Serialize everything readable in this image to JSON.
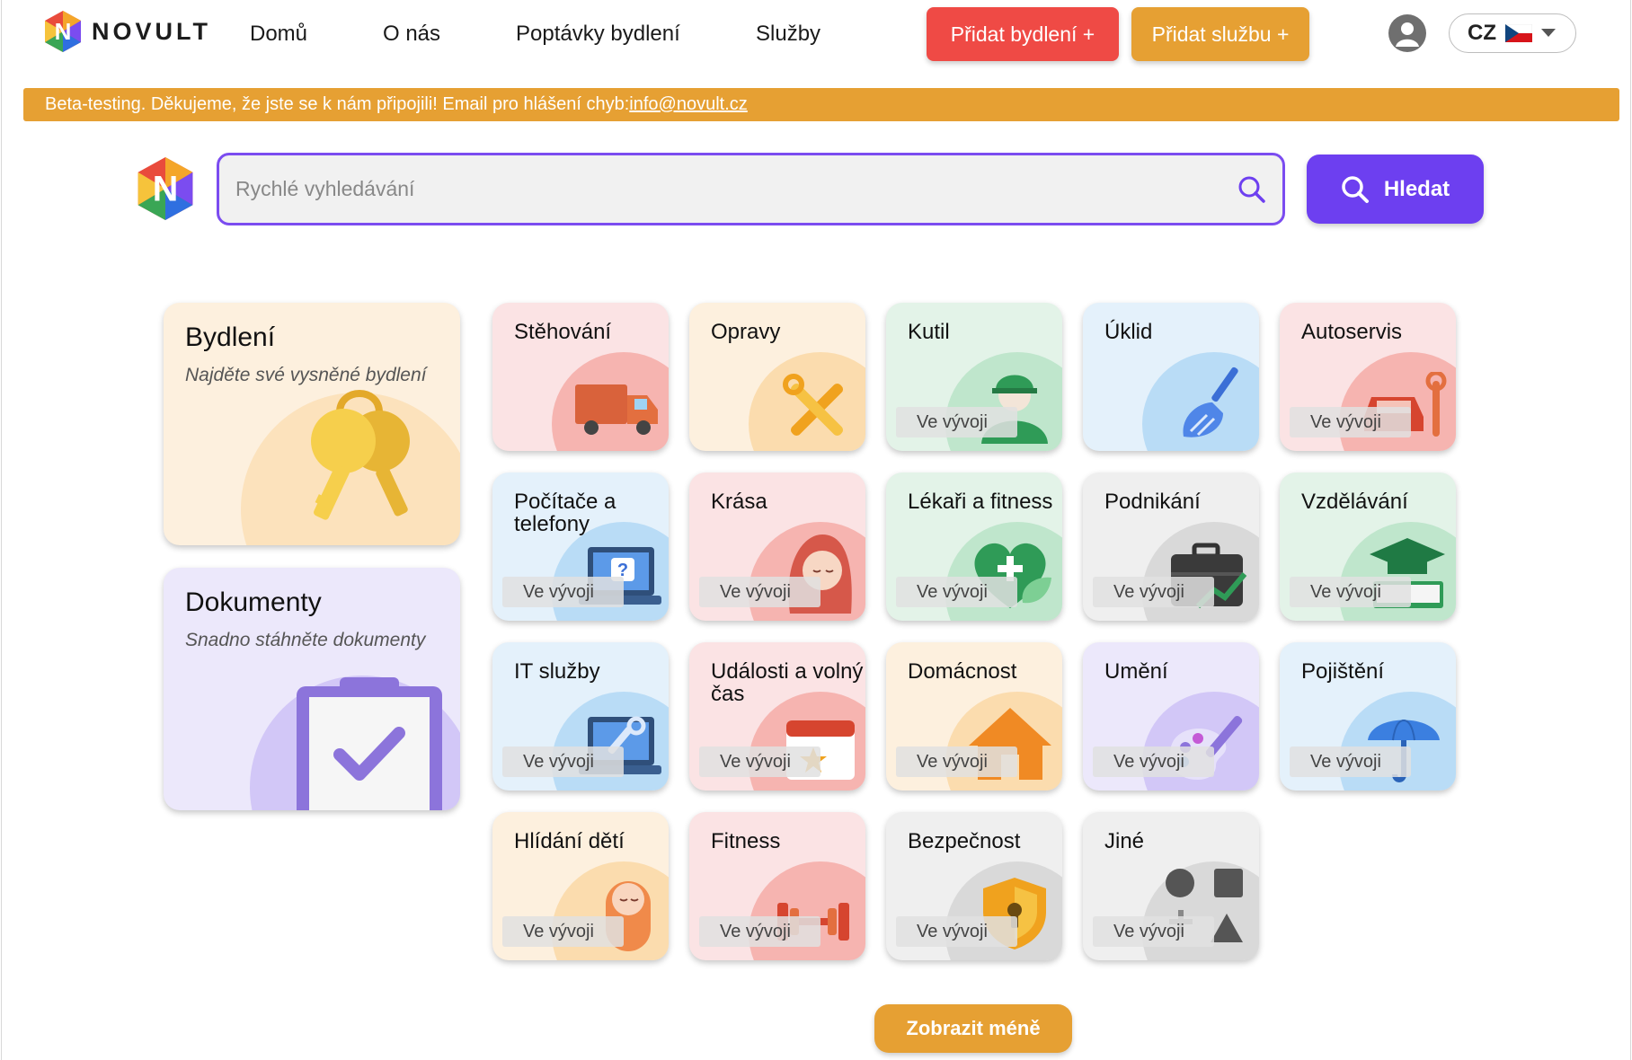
{
  "nav": {
    "brand": "NOVULT",
    "links": [
      "Domů",
      "O nás",
      "Poptávky bydlení",
      "Služby"
    ],
    "add_housing": "Přidat bydlení +",
    "add_service": "Přidat službu +",
    "lang": "CZ"
  },
  "banner": {
    "text": "Beta-testing. Děkujeme, že jste se k nám připojili! Email pro hlášení chyb:",
    "email": "info@novult.cz"
  },
  "search": {
    "placeholder": "Rychlé vyhledávání",
    "button": "Hledat"
  },
  "featured": [
    {
      "title": "Bydlení",
      "subtitle": "Najděte své vysněné bydlení"
    },
    {
      "title": "Dokumenty",
      "subtitle": "Snadno stáhněte dokumenty"
    }
  ],
  "dev_label": "Ve vývoji",
  "categories": [
    {
      "title": "Stěhování",
      "icon": "truck-icon"
    },
    {
      "title": "Opravy",
      "icon": "tools-icon"
    },
    {
      "title": "Kutil",
      "icon": "worker-icon"
    },
    {
      "title": "Úklid",
      "icon": "broom-icon"
    },
    {
      "title": "Autoservis",
      "icon": "car-repair-icon"
    },
    {
      "title": "Počítače a telefony",
      "icon": "laptop-help-icon"
    },
    {
      "title": "Krása",
      "icon": "beauty-face-icon"
    },
    {
      "title": "Lékaři a fitness",
      "icon": "medical-heart-icon"
    },
    {
      "title": "Podnikání",
      "icon": "briefcase-icon"
    },
    {
      "title": "Vzdělávání",
      "icon": "graduation-icon"
    },
    {
      "title": "IT služby",
      "icon": "laptop-wrench-icon"
    },
    {
      "title": "Události a volný čas",
      "icon": "calendar-star-icon"
    },
    {
      "title": "Domácnost",
      "icon": "house-icon"
    },
    {
      "title": "Umění",
      "icon": "palette-icon"
    },
    {
      "title": "Pojištění",
      "icon": "umbrella-icon"
    },
    {
      "title": "Hlídání dětí",
      "icon": "baby-icon"
    },
    {
      "title": "Fitness",
      "icon": "dumbbell-icon"
    },
    {
      "title": "Bezpečnost",
      "icon": "shield-lock-icon"
    },
    {
      "title": "Jiné",
      "icon": "shapes-icon"
    }
  ],
  "show_less": "Zobrazit méně",
  "colors": {
    "accent_purple": "#6d3ff0",
    "accent_orange": "#e6a033",
    "accent_red": "#ef4a45"
  }
}
